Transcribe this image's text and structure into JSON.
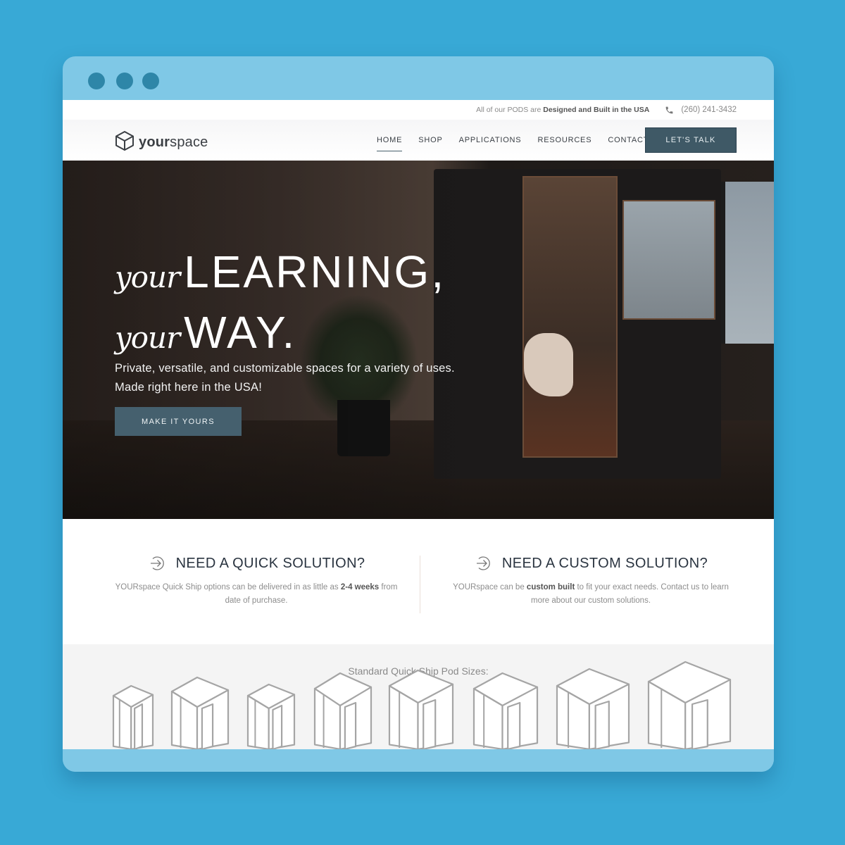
{
  "browser": {
    "window_dots": [
      "dot-1",
      "dot-2",
      "dot-3"
    ]
  },
  "topbar": {
    "notice_prefix": "All of our PODS are",
    "notice_bold": "Designed and Built in the USA",
    "phone_icon": "phone-icon",
    "phone": "(260) 241-3432"
  },
  "header": {
    "logo_icon": "cube-icon",
    "logo_bold": "your",
    "logo_light": "space",
    "nav": [
      {
        "label": "HOME",
        "active": true
      },
      {
        "label": "SHOP",
        "active": false
      },
      {
        "label": "APPLICATIONS",
        "active": false
      },
      {
        "label": "RESOURCES",
        "active": false
      },
      {
        "label": "CONTACT",
        "active": false
      }
    ],
    "cta_label": "LET'S TALK"
  },
  "hero": {
    "line1_script": "your",
    "line1_big": "LEARNING,",
    "line2_script": "your",
    "line2_big": "WAY.",
    "subtitle_1": "Private, versatile, and customizable spaces for a variety of uses.",
    "subtitle_2": "Made right here in the USA!",
    "button_label": "MAKE IT YOURS"
  },
  "solutions": [
    {
      "icon": "arrow-right-circle-icon",
      "title": "NEED A QUICK SOLUTION?",
      "text_pre": "YOURspace Quick Ship options can be delivered in as little as ",
      "text_bold": "2-4 weeks",
      "text_post": " from date of purchase."
    },
    {
      "icon": "arrow-right-circle-icon",
      "title": "NEED A CUSTOM SOLUTION?",
      "text_pre": "YOURspace can be ",
      "text_bold": "custom built",
      "text_post": " to fit your exact needs. Contact us to learn more about our custom solutions."
    }
  ],
  "sizes": {
    "title": "Standard Quick Ship Pod Sizes:",
    "pods": [
      {
        "name": "pod-size-1"
      },
      {
        "name": "pod-size-2"
      },
      {
        "name": "pod-size-3"
      },
      {
        "name": "pod-size-4"
      },
      {
        "name": "pod-size-5"
      },
      {
        "name": "pod-size-6"
      },
      {
        "name": "pod-size-7"
      },
      {
        "name": "pod-size-8"
      }
    ]
  }
}
